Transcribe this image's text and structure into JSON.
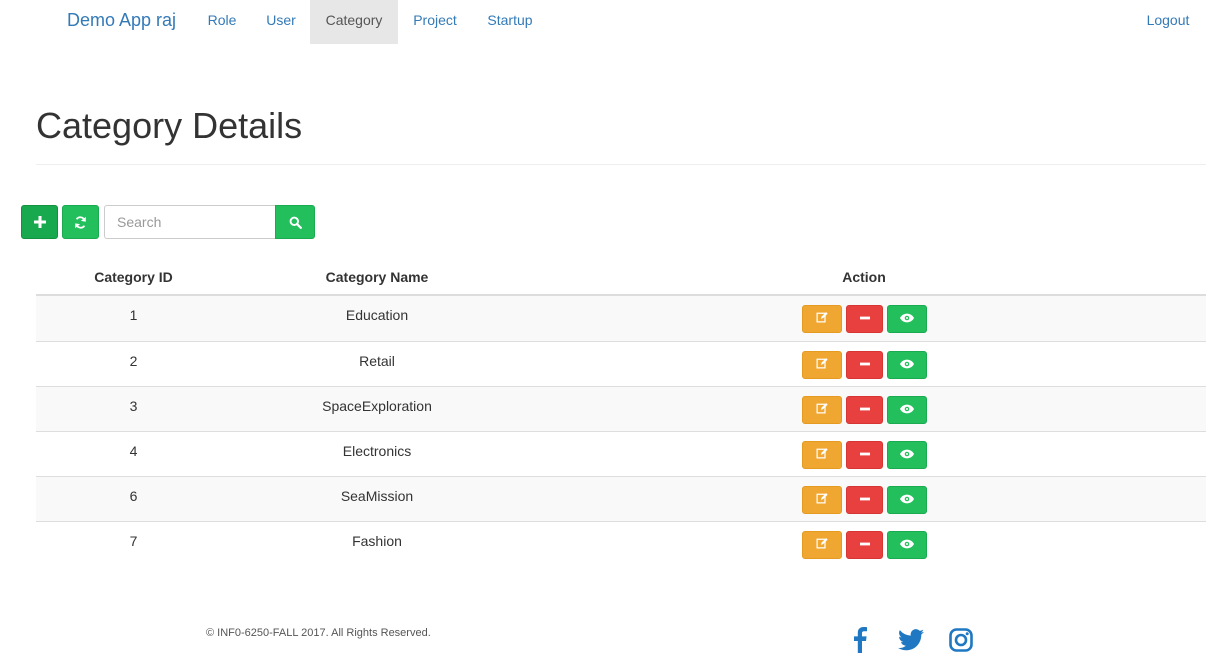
{
  "navbar": {
    "brand": "Demo App raj",
    "items": [
      {
        "label": "Role"
      },
      {
        "label": "User"
      },
      {
        "label": "Category"
      },
      {
        "label": "Project"
      },
      {
        "label": "Startup"
      }
    ],
    "active": "Category",
    "logout": "Logout"
  },
  "page": {
    "title": "Category Details"
  },
  "toolbar": {
    "add_icon": "plus-icon",
    "refresh_icon": "refresh-icon",
    "search_placeholder": "Search",
    "search_value": "",
    "search_icon": "search-icon"
  },
  "table": {
    "headers": [
      "Category ID",
      "Category Name",
      "Action"
    ],
    "rows": [
      {
        "id": "1",
        "name": "Education"
      },
      {
        "id": "2",
        "name": "Retail"
      },
      {
        "id": "3",
        "name": "SpaceExploration"
      },
      {
        "id": "4",
        "name": "Electronics"
      },
      {
        "id": "6",
        "name": "SeaMission"
      },
      {
        "id": "7",
        "name": "Fashion"
      }
    ],
    "row_actions": [
      "edit-icon",
      "minus-icon",
      "eye-icon"
    ]
  },
  "footer": {
    "copyright": "© INF0-6250-FALL 2017. All Rights Reserved.",
    "social": [
      "facebook-icon",
      "twitter-icon",
      "instagram-icon"
    ]
  },
  "colors": {
    "link": "#337ab7",
    "success": "#22bf5c",
    "warning": "#f0a732",
    "danger": "#e8403f",
    "social": "#1f78c1"
  }
}
